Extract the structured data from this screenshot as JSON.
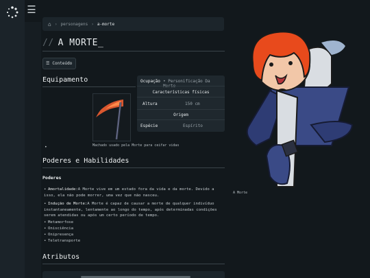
{
  "sidebar": {
    "menu_icon": "menu-icon",
    "logo_icon": "spinner-logo-icon"
  },
  "breadcrumb": {
    "home_icon": "home-icon",
    "items": [
      "personagens",
      "a-morte"
    ]
  },
  "page": {
    "title": "A MORTE_",
    "toc_label": "Conteúdo"
  },
  "sections": {
    "equipment": "Equipamento",
    "abilities": "Poderes e Habilidades",
    "attributes": "Atributos"
  },
  "equipment": {
    "caption": "Machado usado pela Morte para ceifar vidas"
  },
  "infobox": {
    "occupation_label": "Ocupação",
    "occupation_value": "• Personificação Da Morte",
    "physical_header": "Características físicas",
    "height_label": "Altura",
    "height_value": "150 cm",
    "origin_header": "Origem",
    "species_label": "Espécie",
    "species_value": "Espírito"
  },
  "character": {
    "caption": "A Morte"
  },
  "abilities": {
    "subheading": "Poderes",
    "immortality_key": "Amortalidade:",
    "immortality_text": "A Morte vive em um estado fora da vida e da morte. Devido a isso, ela não pode morrer, uma vez que não nasceu.",
    "death_key": "Indução de Morte:",
    "death_text": "A Morte é capaz de causar a morte de qualquer indivíduo instantaneamente, lentamente ao longo do tempo, após determinadas condições serem atendidas ou após um certo período de tempo.",
    "items": [
      "Metamorfose",
      "Onisciência",
      "Onipresença",
      "Teletransporte"
    ]
  }
}
